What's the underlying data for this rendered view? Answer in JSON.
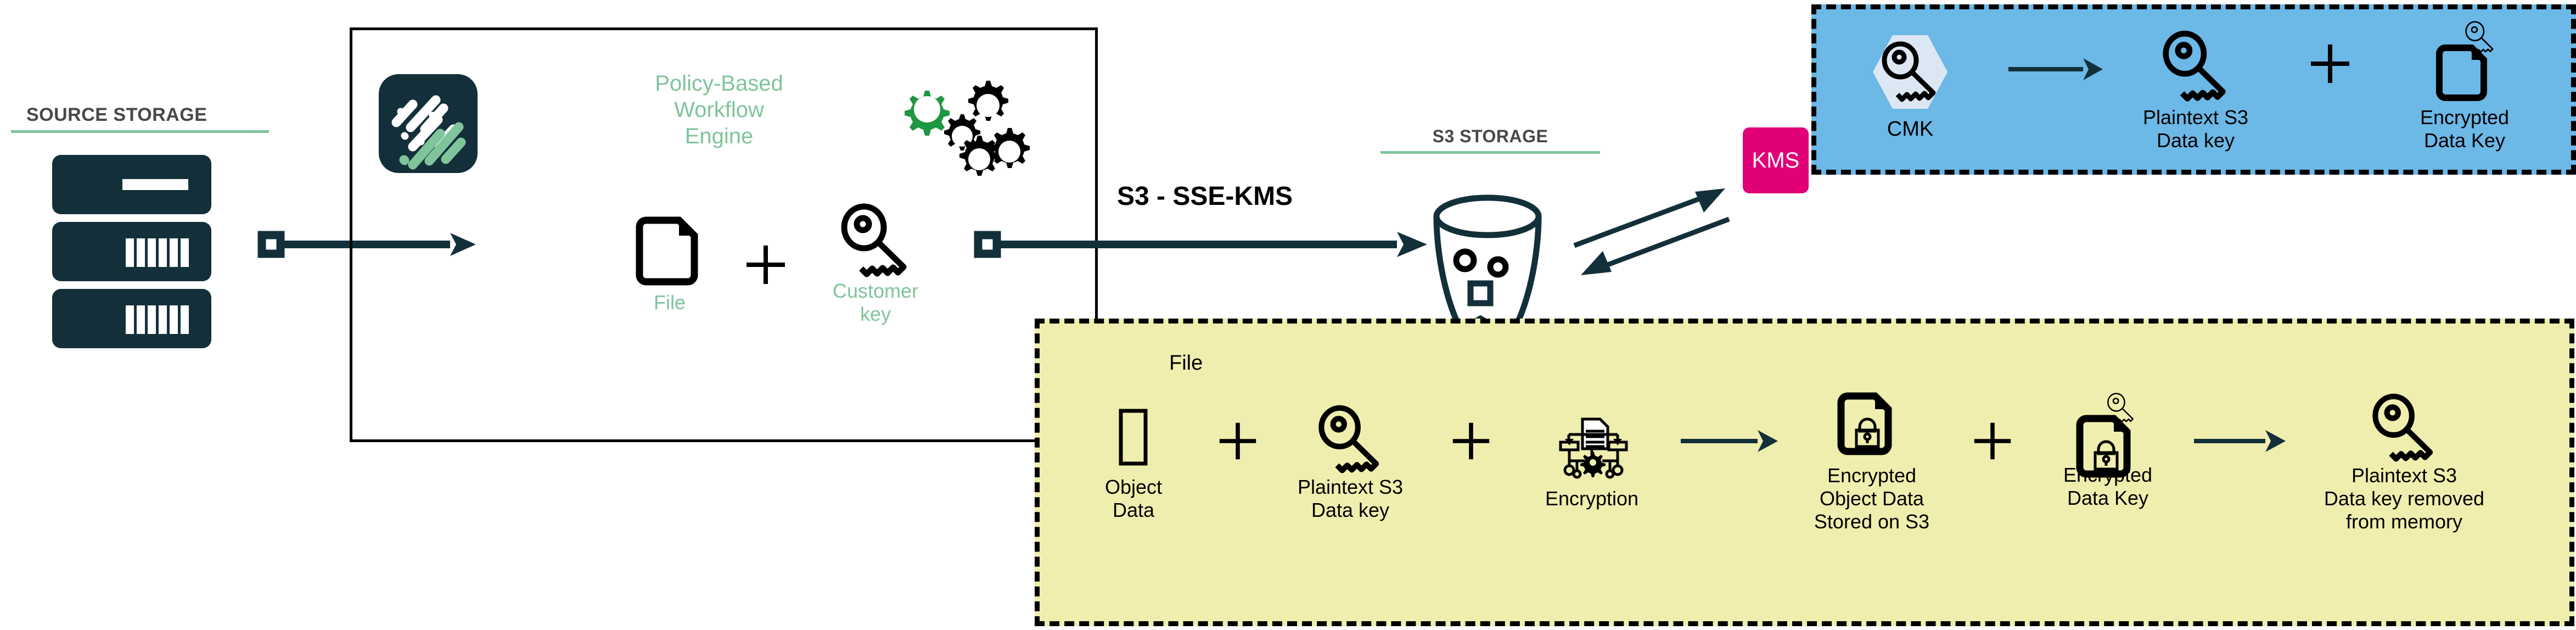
{
  "colors": {
    "dark_navy": "#13303a",
    "green_accent": "#7fc49b",
    "gear_green": "#1e9642",
    "kms_pink": "#e10078",
    "blue_panel": "#6cb8e6",
    "yellow_panel": "#f0eeae",
    "hex_light": "#dde7f3",
    "header_text": "#4a4746",
    "black": "#000000"
  },
  "source_storage": {
    "title": "SOURCE STORAGE",
    "icon": "server-rack-icon"
  },
  "workflow_engine": {
    "logo_icon": "app-logo-icon",
    "title": "Policy-Based\nWorkflow\nEngine",
    "title_lines": [
      "Policy-Based",
      "Workflow",
      "Engine"
    ],
    "gears_icon": "gears-icon",
    "inputs": [
      {
        "icon": "file-icon",
        "label_lines": [
          "File"
        ]
      },
      {
        "icon": "plus-icon",
        "label_lines": []
      },
      {
        "icon": "key-icon",
        "label_lines": [
          "Customer",
          "key"
        ]
      }
    ]
  },
  "flow": {
    "transfer_label": "S3 - SSE-KMS"
  },
  "s3_storage": {
    "title": "S3 STORAGE",
    "bucket_icon": "s3-bucket-icon"
  },
  "kms": {
    "label": "KMS"
  },
  "blue_panel": {
    "items": [
      {
        "icon": "cmk-hexagon-key-icon",
        "label_lines": [
          "CMK"
        ]
      },
      {
        "icon": "arrow-right-icon",
        "label_lines": []
      },
      {
        "icon": "key-icon",
        "label_lines": [
          "Plaintext S3",
          "Data key"
        ]
      },
      {
        "icon": "plus-icon",
        "label_lines": []
      },
      {
        "icon": "encrypted-data-key-icon",
        "label_lines": [
          "Encrypted",
          "Data Key"
        ]
      }
    ]
  },
  "yellow_panel": {
    "caption": "File",
    "items": [
      {
        "icon": "object-data-icon",
        "label_lines": [
          "Object",
          "Data"
        ]
      },
      {
        "icon": "plus-icon",
        "label_lines": []
      },
      {
        "icon": "key-icon",
        "label_lines": [
          "Plaintext S3",
          "Data key"
        ]
      },
      {
        "icon": "plus-icon",
        "label_lines": []
      },
      {
        "icon": "encryption-icon",
        "label_lines": [
          "Encryption"
        ]
      },
      {
        "icon": "arrow-right-icon",
        "label_lines": []
      },
      {
        "icon": "encrypted-object-icon",
        "label_lines": [
          "Encrypted",
          "Object Data",
          "Stored on S3"
        ]
      },
      {
        "icon": "plus-icon",
        "label_lines": []
      },
      {
        "icon": "encrypted-data-key-icon",
        "label_lines": [
          "Encrypted",
          "Data Key"
        ]
      },
      {
        "icon": "arrow-right-icon",
        "label_lines": []
      },
      {
        "icon": "key-icon",
        "label_lines": [
          "Plaintext S3",
          "Data key removed",
          "from memory"
        ]
      }
    ]
  }
}
